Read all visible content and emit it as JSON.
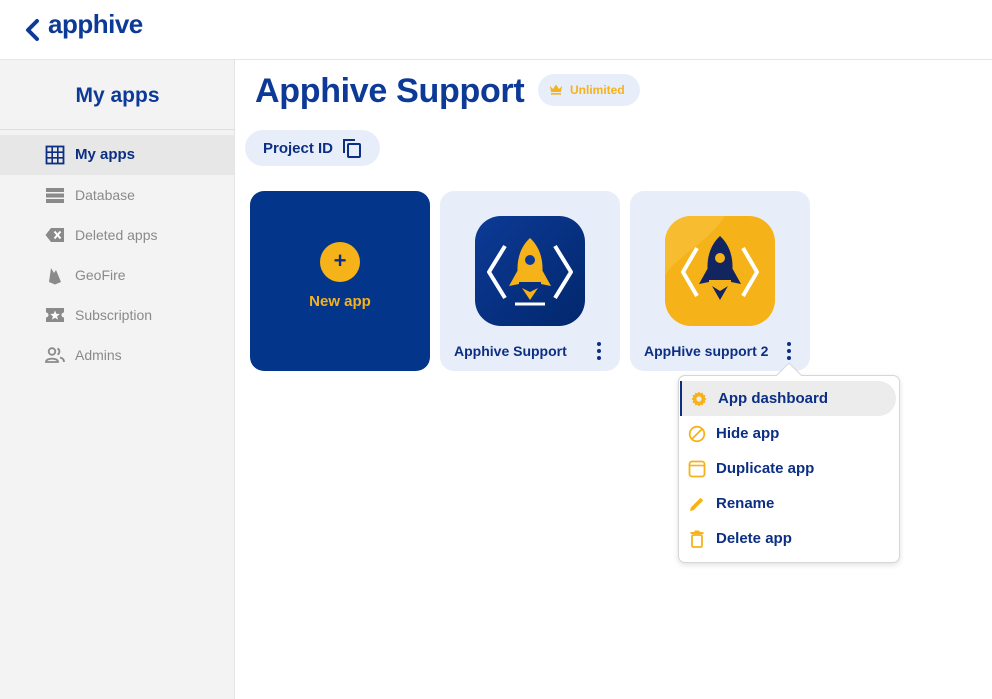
{
  "app": {
    "logo_text": "apphive",
    "back_icon": "chevron-left-icon"
  },
  "sidebar": {
    "title": "My apps",
    "items": [
      {
        "label": "My apps",
        "icon": "grid-icon",
        "active": true
      },
      {
        "label": "Database",
        "icon": "database-icon",
        "active": false
      },
      {
        "label": "Deleted apps",
        "icon": "backspace-icon",
        "active": false
      },
      {
        "label": "GeoFire",
        "icon": "firebase-icon",
        "active": false
      },
      {
        "label": "Subscription",
        "icon": "ticket-star-icon",
        "active": false
      },
      {
        "label": "Admins",
        "icon": "people-icon",
        "active": false
      }
    ]
  },
  "header": {
    "title": "Apphive Support",
    "plan_badge": "Unlimited",
    "project_id_label": "Project ID"
  },
  "cards": {
    "new_app_label": "New app",
    "new_app_symbol": "+",
    "apps": [
      {
        "name": "Apphive Support",
        "icon": "rocket-icon-blue"
      },
      {
        "name": "AppHive support 2",
        "icon": "rocket-icon-yellow"
      }
    ]
  },
  "context_menu": {
    "items": [
      {
        "label": "App dashboard",
        "icon": "gear-icon",
        "active": true
      },
      {
        "label": "Hide app",
        "icon": "block-icon",
        "active": false
      },
      {
        "label": "Duplicate app",
        "icon": "duplicate-icon",
        "active": false
      },
      {
        "label": "Rename",
        "icon": "pencil-icon",
        "active": false
      },
      {
        "label": "Delete app",
        "icon": "trash-icon",
        "active": false
      }
    ]
  },
  "colors": {
    "brand_blue": "#0c3a96",
    "dark_blue": "#03358b",
    "accent_yellow": "#f6b319",
    "card_bg": "#e8eef9"
  }
}
